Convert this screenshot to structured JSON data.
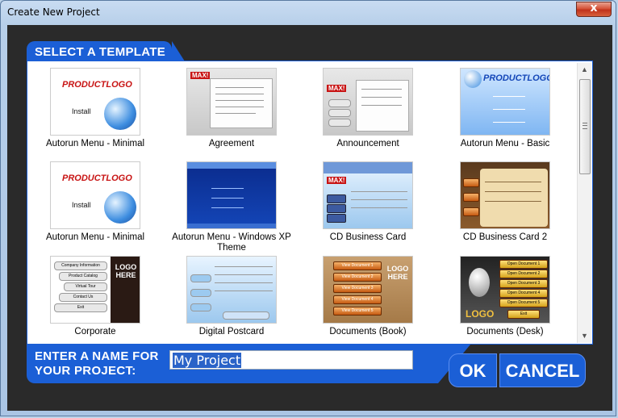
{
  "window": {
    "title": "Create New Project",
    "close_symbol": "x"
  },
  "section": {
    "select_template": "SELECT A TEMPLATE"
  },
  "templates": [
    {
      "label": "Autorun Menu - Minimal",
      "style": "white",
      "logo": "PRODUCTLOGO",
      "action": "Install"
    },
    {
      "label": "Agreement",
      "style": "gray",
      "badge": "MAX!"
    },
    {
      "label": "Announcement",
      "style": "gray",
      "badge": "MAX!"
    },
    {
      "label": "Autorun Menu - Basic",
      "style": "lightblue",
      "logo": "PRODUCTLOGO"
    },
    {
      "label": "Autorun Menu - Minimal",
      "style": "white",
      "logo": "PRODUCTLOGO",
      "action": "Install"
    },
    {
      "label": "Autorun Menu - Windows XP Theme",
      "style": "blue"
    },
    {
      "label": "CD Business Card",
      "style": "sky",
      "badge": "MAX!"
    },
    {
      "label": "CD Business Card 2",
      "style": "brown"
    },
    {
      "label": "Corporate",
      "style": "white",
      "buttons": [
        "Company Information",
        "Product Catalog",
        "Virtual Tour",
        "Contact Us",
        "Exit"
      ],
      "logo_text": "LOGO HERE"
    },
    {
      "label": "Digital Postcard",
      "style": "sky"
    },
    {
      "label": "Documents (Book)",
      "style": "cork",
      "buttons": [
        "View Document 1",
        "View Document 2",
        "View Document 3",
        "View Document 4",
        "View Document 5"
      ],
      "logo_text": "LOGO HERE"
    },
    {
      "label": "Documents (Desk)",
      "style": "black",
      "buttons": [
        "Open Document 1",
        "Open Document 2",
        "Open Document 3",
        "Open Document 4",
        "Open Document 5",
        "Exit"
      ],
      "logo_text": "LOGO"
    }
  ],
  "name_prompt": {
    "line1": "ENTER A NAME FOR",
    "line2": "YOUR PROJECT:"
  },
  "project_name": {
    "value": "My Project"
  },
  "buttons": {
    "ok": "OK",
    "cancel": "CANCEL"
  },
  "colors": {
    "accent": "#1b5fd6",
    "title_bg": "#bcd3ea",
    "close": "#c0321a"
  }
}
